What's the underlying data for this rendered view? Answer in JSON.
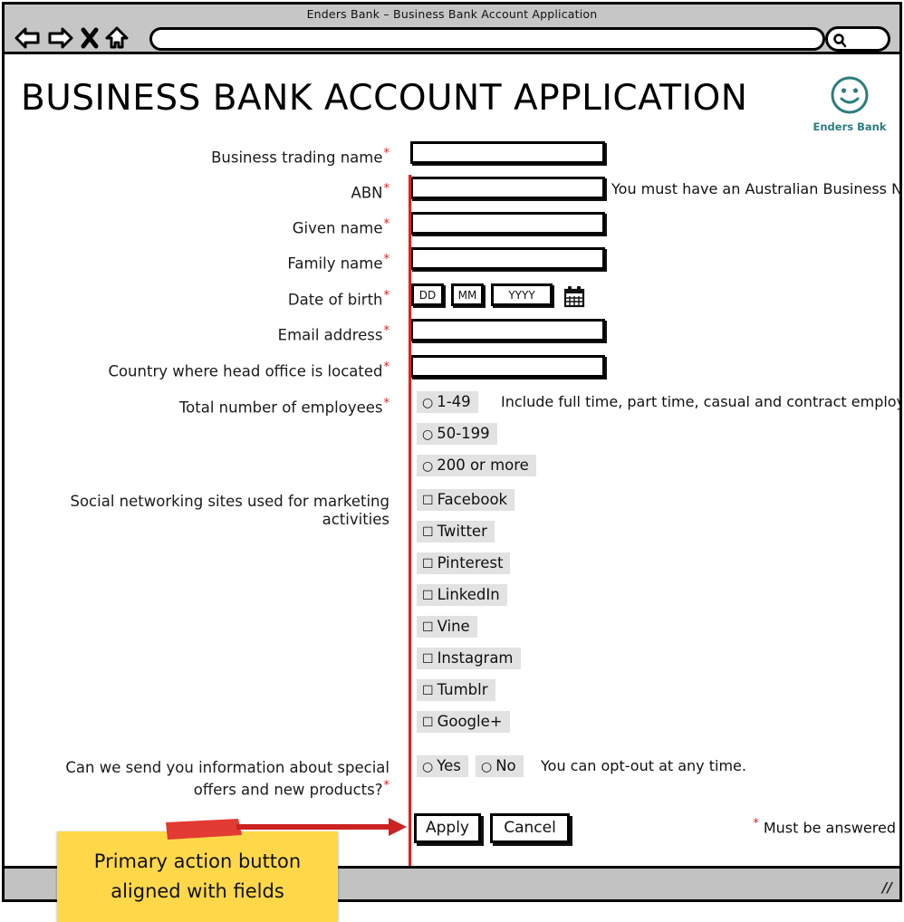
{
  "window": {
    "title": "Enders Bank – Business Bank Account Application",
    "nav_icons": [
      "back-arrow-icon",
      "forward-arrow-icon",
      "stop-x-icon",
      "home-icon"
    ],
    "url_value": "",
    "url_placeholder": "",
    "search_value": "",
    "search_icon": "search-icon"
  },
  "brand": {
    "logo_icon": "smiley-face-logo-icon",
    "name": "Enders Bank",
    "color": "#2d7d7d"
  },
  "page": {
    "title": "BUSINESS BANK ACCOUNT APPLICATION",
    "required_marker": "*",
    "footnote_marker": "*",
    "footnote": "Must be answered"
  },
  "fields": {
    "business_trading_name": {
      "label": "Business trading name",
      "required": true,
      "value": ""
    },
    "abn": {
      "label": "ABN",
      "required": true,
      "value": "",
      "help": "You must have an Australian Business N"
    },
    "given_name": {
      "label": "Given name",
      "required": true,
      "value": ""
    },
    "family_name": {
      "label": "Family name",
      "required": true,
      "value": ""
    },
    "date_of_birth": {
      "label": "Date of birth",
      "required": true,
      "day_placeholder": "DD",
      "month_placeholder": "MM",
      "year_placeholder": "YYYY",
      "day_value": "",
      "month_value": "",
      "year_value": "",
      "calendar_icon": "calendar-icon"
    },
    "email_address": {
      "label": "Email address",
      "required": true,
      "value": ""
    },
    "head_office_country": {
      "label": "Country where head office is located",
      "required": true,
      "value": ""
    },
    "employees": {
      "label": "Total number of employees",
      "required": true,
      "help": "Include full time, part time, casual and contract employ",
      "options": [
        "1-49",
        "50-199",
        "200 or more"
      ],
      "selected": ""
    },
    "social_sites": {
      "label_line1": "Social networking sites used for marketing",
      "label_line2": "activities",
      "required": false,
      "options": [
        "Facebook",
        "Twitter",
        "Pinterest",
        "LinkedIn",
        "Vine",
        "Instagram",
        "Tumblr",
        "Google+"
      ],
      "selected": []
    },
    "marketing_optin": {
      "label_line1": "Can we send you information about special",
      "label_line2": "offers and new products?",
      "required": true,
      "help": "You can opt-out at any time.",
      "options": [
        "Yes",
        "No"
      ],
      "selected": ""
    }
  },
  "buttons": {
    "apply": "Apply",
    "cancel": "Cancel"
  },
  "annotation": {
    "line1": "Primary action button",
    "line2": "aligned with fields",
    "note_color": "#ffd84a",
    "arrow_color": "#cc2222"
  }
}
